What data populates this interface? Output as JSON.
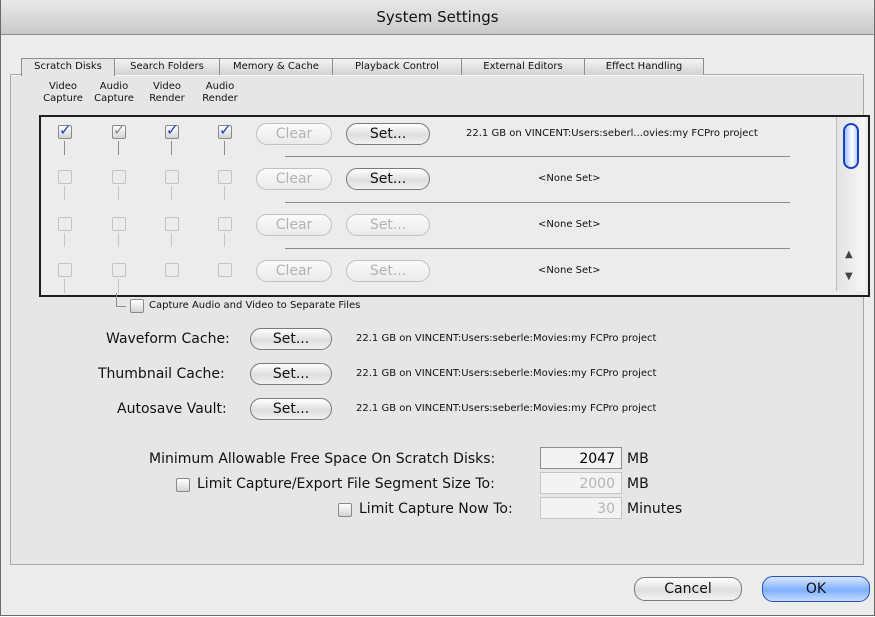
{
  "window": {
    "title": "System Settings"
  },
  "tabs": [
    "Scratch Disks",
    "Search Folders",
    "Memory & Cache",
    "Playback Control",
    "External Editors",
    "Effect Handling"
  ],
  "columns": [
    {
      "line1": "Video",
      "line2": "Capture"
    },
    {
      "line1": "Audio",
      "line2": "Capture"
    },
    {
      "line1": "Video",
      "line2": "Render"
    },
    {
      "line1": "Audio",
      "line2": "Render"
    }
  ],
  "scratch_disks": [
    {
      "checks": [
        true,
        true,
        true,
        true
      ],
      "clear_label": "Clear",
      "set_label": "Set...",
      "set_enabled": true,
      "path": "22.1 GB on  VINCENT:Users:seberl...ovies:my FCPro project"
    },
    {
      "checks": [
        false,
        false,
        false,
        false
      ],
      "clear_label": "Clear",
      "set_label": "Set...",
      "set_enabled": true,
      "path": "<None Set>"
    },
    {
      "checks": [
        false,
        false,
        false,
        false
      ],
      "clear_label": "Clear",
      "set_label": "Set...",
      "set_enabled": false,
      "path": "<None Set>"
    },
    {
      "checks": [
        false,
        false,
        false,
        false
      ],
      "clear_label": "Clear",
      "set_label": "Set...",
      "set_enabled": false,
      "path": "<None Set>"
    }
  ],
  "separate_files": {
    "label": "Capture Audio and Video to Separate Files",
    "checked": false
  },
  "caches": [
    {
      "label": "Waveform Cache:",
      "button": "Set...",
      "path": "22.1 GB on  VINCENT:Users:seberle:Movies:my FCPro project"
    },
    {
      "label": "Thumbnail Cache:",
      "button": "Set...",
      "path": "22.1 GB on  VINCENT:Users:seberle:Movies:my FCPro project"
    },
    {
      "label": "Autosave Vault:",
      "button": "Set...",
      "path": "22.1 GB on  VINCENT:Users:seberle:Movies:my FCPro project"
    }
  ],
  "limits": {
    "min_free": {
      "label": "Minimum Allowable Free Space On Scratch Disks:",
      "value": "2047",
      "unit": "MB"
    },
    "segment": {
      "label": "Limit Capture/Export File Segment Size To:",
      "value": "2000",
      "unit": "MB",
      "checked": false
    },
    "capture_now": {
      "label": "Limit Capture Now To:",
      "value": "30",
      "unit": "Minutes",
      "checked": false
    }
  },
  "footer": {
    "cancel": "Cancel",
    "ok": "OK"
  },
  "colors": {
    "accent": "#1b3fbf",
    "ok_button": "#9cc3ff"
  }
}
